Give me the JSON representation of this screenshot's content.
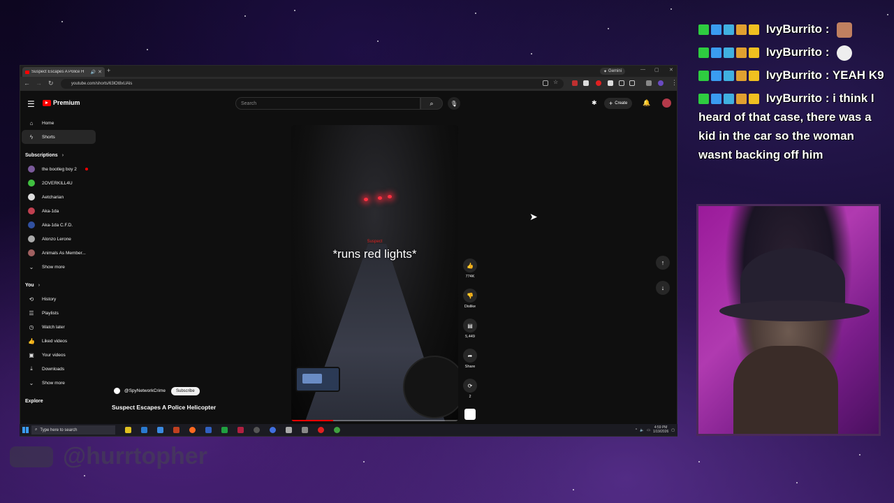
{
  "browser": {
    "tab_title": "Suspect Escapes A Police H",
    "gemini_label": "Gemini",
    "url": "youtube.com/shorts/63lOt8xUAls"
  },
  "youtube": {
    "logo_text": "Premium",
    "search_placeholder": "Search",
    "create_label": "Create"
  },
  "sidebar": {
    "main": [
      {
        "label": "Home",
        "icon": "home-icon"
      },
      {
        "label": "Shorts",
        "icon": "shorts-icon"
      }
    ],
    "subscriptions_header": "Subscriptions",
    "subscriptions": [
      {
        "label": "the bootleg boy 2",
        "color": "#7a5a9a",
        "live": true
      },
      {
        "label": "2OVERKILL4U",
        "color": "#40c040",
        "live": false
      },
      {
        "label": "Aetcharian",
        "color": "#dddddd",
        "live": false
      },
      {
        "label": "Aka-1da",
        "color": "#c04050",
        "live": false
      },
      {
        "label": "Aka-1da C.F.D.",
        "color": "#3050a0",
        "live": false
      },
      {
        "label": "Alonzo Lerone",
        "color": "#aaaaaa",
        "live": false
      },
      {
        "label": "Animals As Member...",
        "color": "#a06060",
        "live": false
      }
    ],
    "show_more_1": "Show more",
    "you_header": "You",
    "you_items": [
      {
        "label": "History",
        "icon": "history-icon"
      },
      {
        "label": "Playlists",
        "icon": "playlists-icon"
      },
      {
        "label": "Watch later",
        "icon": "watch-later-icon"
      },
      {
        "label": "Liked videos",
        "icon": "liked-icon"
      },
      {
        "label": "Your videos",
        "icon": "your-videos-icon"
      },
      {
        "label": "Downloads",
        "icon": "downloads-icon"
      }
    ],
    "show_more_2": "Show more",
    "explore_header": "Explore"
  },
  "video": {
    "caption_small": "Suspect",
    "caption": "*runs red lights*",
    "channel": "@SpyNetworkCrime",
    "subscribe": "Subscribe",
    "title": "Suspect Escapes A Police Helicopter",
    "progress": 0.25
  },
  "actions": {
    "like_count": "774K",
    "dislike_label": "Dislike",
    "comments_count": "5,449",
    "share_label": "Share",
    "remix_count": "2"
  },
  "taskbar": {
    "search_placeholder": "Type here to search",
    "time": "4:59 PM",
    "date": "1/19/2026"
  },
  "chat": [
    {
      "user": "IvyBurrito",
      "text": "",
      "emote": "face-emote"
    },
    {
      "user": "IvyBurrito",
      "text": "",
      "emote": "skull-emote"
    },
    {
      "user": "IvyBurrito",
      "text": "YEAH K9",
      "emote": null
    },
    {
      "user": "IvyBurrito",
      "text": "i think I heard of that case, there was a kid in the car so the woman wasnt backing off him",
      "emote": null
    }
  ],
  "watermark": "@hurrtopher",
  "colors": {
    "brand_red": "#ff0000",
    "badge_colors": [
      "#2ecc40",
      "#3a9cf0",
      "#40b0e0",
      "#e0a030",
      "#f0c020"
    ]
  }
}
